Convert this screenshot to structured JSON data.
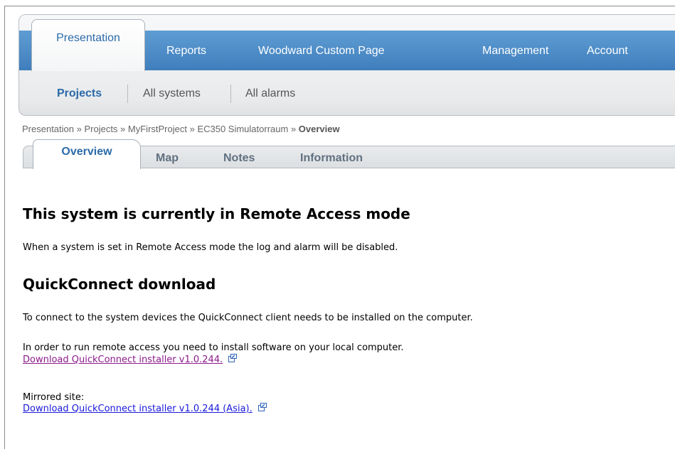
{
  "topnav": {
    "tabs": [
      {
        "label": "Presentation",
        "active": true
      },
      {
        "label": "Reports"
      },
      {
        "label": "Woodward Custom Page"
      },
      {
        "label": "Management"
      },
      {
        "label": "Account"
      }
    ]
  },
  "subnav": {
    "items": [
      {
        "label": "Projects",
        "active": true
      },
      {
        "label": "All systems"
      },
      {
        "label": "All alarms"
      }
    ]
  },
  "breadcrumb": {
    "parts": [
      "Presentation",
      "Projects",
      "MyFirstProject",
      "EC350 Simulatorraum"
    ],
    "separator": " » ",
    "current": "Overview"
  },
  "subtabs": [
    {
      "label": "Overview",
      "active": true
    },
    {
      "label": "Map"
    },
    {
      "label": "Notes"
    },
    {
      "label": "Information"
    }
  ],
  "content": {
    "heading1": "This system is currently in Remote Access mode",
    "remote_text": "When a system is set in Remote Access mode the log and alarm will be disabled.",
    "heading2": "QuickConnect download",
    "connect_text": "To connect to the system devices the QuickConnect client needs to be installed on the computer.",
    "run_text": "In order to run remote access you need to install software on your local computer.",
    "download_link": "Download QuickConnect installer v1.0.244.",
    "mirror_label": "Mirrored site:",
    "mirror_link": "Download QuickConnect installer v1.0.244 (Asia)."
  },
  "colors": {
    "nav_blue": "#4a89c6",
    "active_text": "#2b6aa9",
    "link": "#1a1adb",
    "visited_link": "#8b1a8b"
  },
  "icons": [
    "external-link-icon"
  ]
}
